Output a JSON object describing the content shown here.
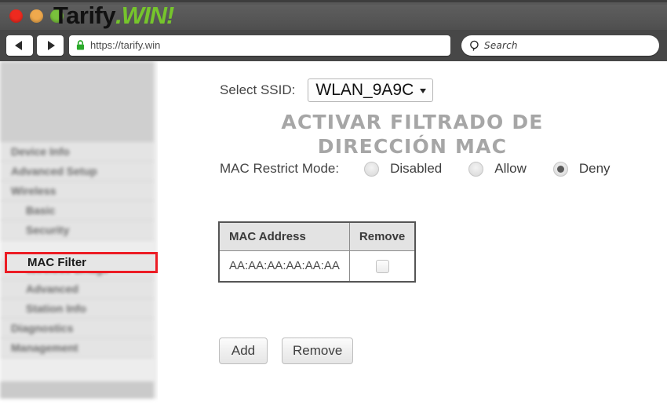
{
  "window": {
    "logo_dark": "Tarify",
    "logo_green": ".WIN!",
    "lights": [
      "close-red",
      "minimize-amber",
      "maximize-green"
    ]
  },
  "toolbar": {
    "back_icon": "back-arrow-icon",
    "forward_icon": "forward-arrow-icon",
    "lock_icon": "padlock-icon",
    "url": "https://tarify.win",
    "search_icon": "search-magnifier-icon",
    "search_placeholder": "Search"
  },
  "sidebar": {
    "items": [
      {
        "label": "Device Info",
        "level": 0,
        "active": false
      },
      {
        "label": "Advanced Setup",
        "level": 0,
        "active": false
      },
      {
        "label": "Wireless",
        "level": 0,
        "active": false
      },
      {
        "label": "Basic",
        "level": 1,
        "active": false
      },
      {
        "label": "Security",
        "level": 1,
        "active": false
      },
      {
        "label": "MAC Filter",
        "level": 1,
        "active": true
      },
      {
        "label": "Wireless Bridge",
        "level": 1,
        "active": false
      },
      {
        "label": "Advanced",
        "level": 1,
        "active": false
      },
      {
        "label": "Station Info",
        "level": 1,
        "active": false
      },
      {
        "label": "Diagnostics",
        "level": 0,
        "active": false
      },
      {
        "label": "Management",
        "level": 0,
        "active": false
      }
    ],
    "active_label": "MAC Filter",
    "highlight_color": "#ec1c24"
  },
  "main": {
    "ssid_label": "Select SSID:",
    "ssid_value": "WLAN_9A9C",
    "overlay_title_line1": "ACTIVAR FILTRADO DE",
    "overlay_title_line2": "DIRECCIÓN MAC",
    "restrict_label": "MAC Restrict Mode:",
    "restrict_options": [
      {
        "label": "Disabled",
        "checked": false
      },
      {
        "label": "Allow",
        "checked": false
      },
      {
        "label": "Deny",
        "checked": true
      }
    ],
    "table": {
      "headers": [
        "MAC Address",
        "Remove"
      ],
      "rows": [
        {
          "mac": "AA:AA:AA:AA:AA:AA",
          "remove_checked": false
        }
      ]
    },
    "buttons": [
      {
        "label": "Add"
      },
      {
        "label": "Remove"
      }
    ]
  }
}
